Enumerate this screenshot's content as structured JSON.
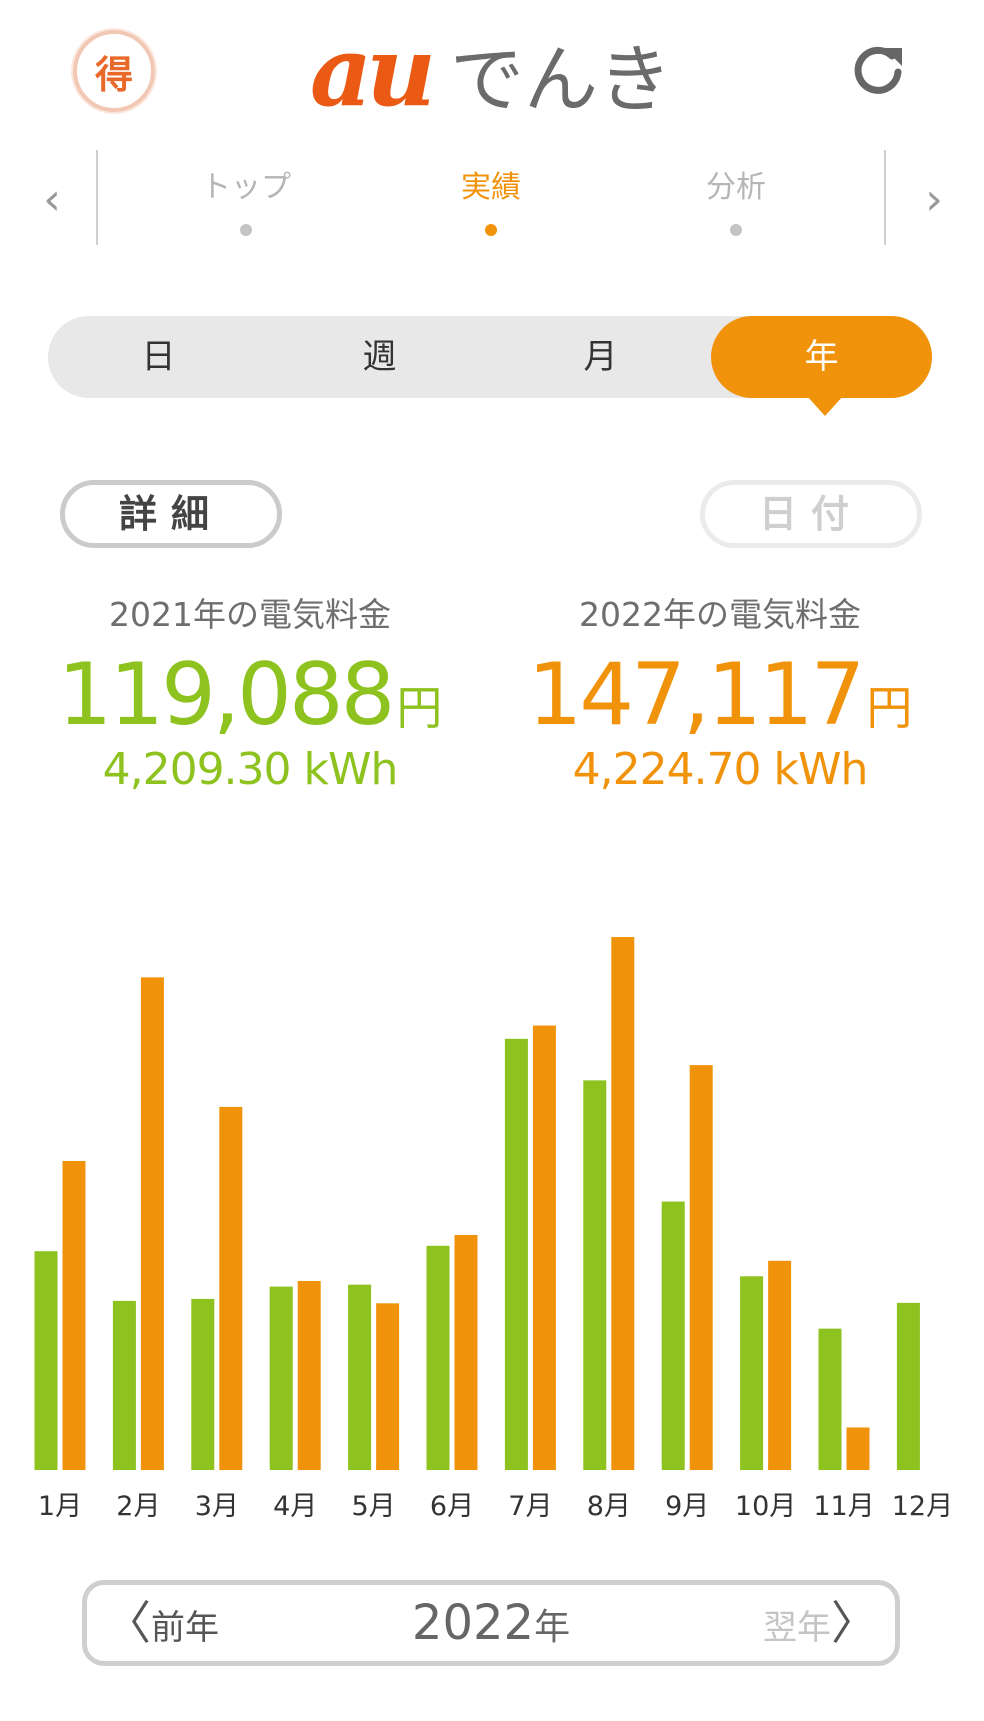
{
  "header": {
    "toku_label": "得",
    "logo_au": "au",
    "logo_denki": "でんき"
  },
  "nav": {
    "tabs": [
      {
        "label": "トップ",
        "active": false
      },
      {
        "label": "実績",
        "active": true
      },
      {
        "label": "分析",
        "active": false
      }
    ],
    "prev_arrow": "‹",
    "next_arrow": "›"
  },
  "period": {
    "items": [
      "日",
      "週",
      "月",
      "年"
    ],
    "selected": "年"
  },
  "buttons": {
    "detail": "詳細",
    "date": "日付"
  },
  "totals": [
    {
      "label": "2021年の電気料金",
      "amount": "119,088",
      "unit": "円",
      "kwh": "4,209.30 kWh",
      "color": "#8dc21f"
    },
    {
      "label": "2022年の電気料金",
      "amount": "147,117",
      "unit": "円",
      "kwh": "4,224.70 kWh",
      "color": "#f0930a"
    }
  ],
  "chart_data": {
    "type": "bar",
    "categories": [
      "1月",
      "2月",
      "3月",
      "4月",
      "5月",
      "6月",
      "7月",
      "8月",
      "9月",
      "10月",
      "11月",
      "12月"
    ],
    "series": [
      {
        "values": [
          8900,
          6880,
          6960,
          7460,
          7540,
          9120,
          17540,
          15850,
          10920,
          7880,
          5750,
          6800
        ],
        "color": "#8dc21f"
      },
      {
        "values": [
          12570,
          20040,
          14770,
          7690,
          6780,
          9560,
          18080,
          21680,
          16470,
          8510,
          1730,
          null
        ],
        "color": "#f0930a"
      }
    ],
    "ylim": [
      0,
      24000
    ],
    "grid": false,
    "legend": "none"
  },
  "year_nav": {
    "prev_label": "前年",
    "next_label": "翌年",
    "year": "2022",
    "year_unit": "年",
    "chev_left": "〈",
    "chev_right": "〉"
  }
}
